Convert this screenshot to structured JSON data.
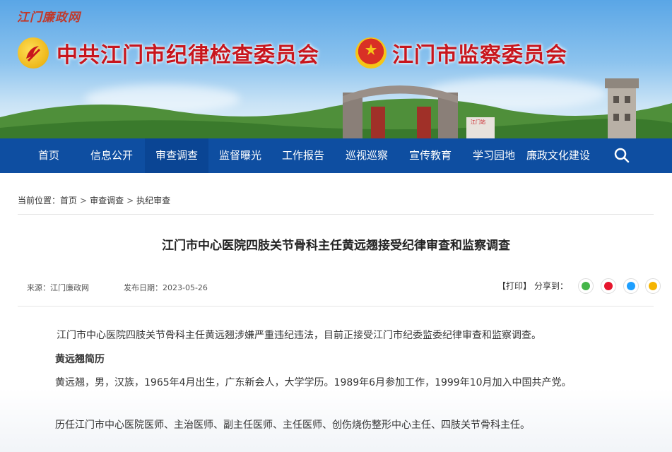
{
  "site": {
    "logo_text": "江门廉政网",
    "org_title_1": "中共江门市纪律检查委员会",
    "org_title_2": "江门市监察委员会",
    "station_sign": "江门站",
    "colors": {
      "nav_bg": "#0e4ea1",
      "title_red": "#c8161d"
    }
  },
  "nav": {
    "items": [
      {
        "label": "首页"
      },
      {
        "label": "信息公开"
      },
      {
        "label": "审查调查",
        "active": true
      },
      {
        "label": "监督曝光"
      },
      {
        "label": "工作报告"
      },
      {
        "label": "巡视巡察"
      },
      {
        "label": "宣传教育"
      },
      {
        "label": "学习园地"
      },
      {
        "label": "廉政文化建设"
      }
    ],
    "search_icon": "search-icon"
  },
  "breadcrumb": {
    "prefix": "当前位置：",
    "items": [
      "首页",
      "审查调查",
      "执纪审查"
    ],
    "separator": ">"
  },
  "article": {
    "title": "江门市中心医院四肢关节骨科主任黄远翘接受纪律审查和监察调查",
    "source": "来源：江门廉政网",
    "date": "发布日期：2023-05-26",
    "print_label": "【打印】",
    "share_label": "分享到：",
    "share_icons": [
      "wechat-icon",
      "weibo-icon",
      "qq-icon",
      "qzone-icon"
    ],
    "paragraph_1": "江门市中心医院四肢关节骨科主任黄远翘涉嫌严重违纪违法，目前正接受江门市纪委监委纪律审查和监察调查。",
    "bio_heading": "黄远翘简历",
    "paragraph_2": "黄远翘，男，汉族，1965年4月出生，广东新会人，大学学历。1989年6月参加工作，1999年10月加入中国共产党。",
    "paragraph_3": "历任江门市中心医院医师、主治医师、副主任医师、主任医师、创伤烧伤整形中心主任、四肢关节骨科主任。"
  }
}
